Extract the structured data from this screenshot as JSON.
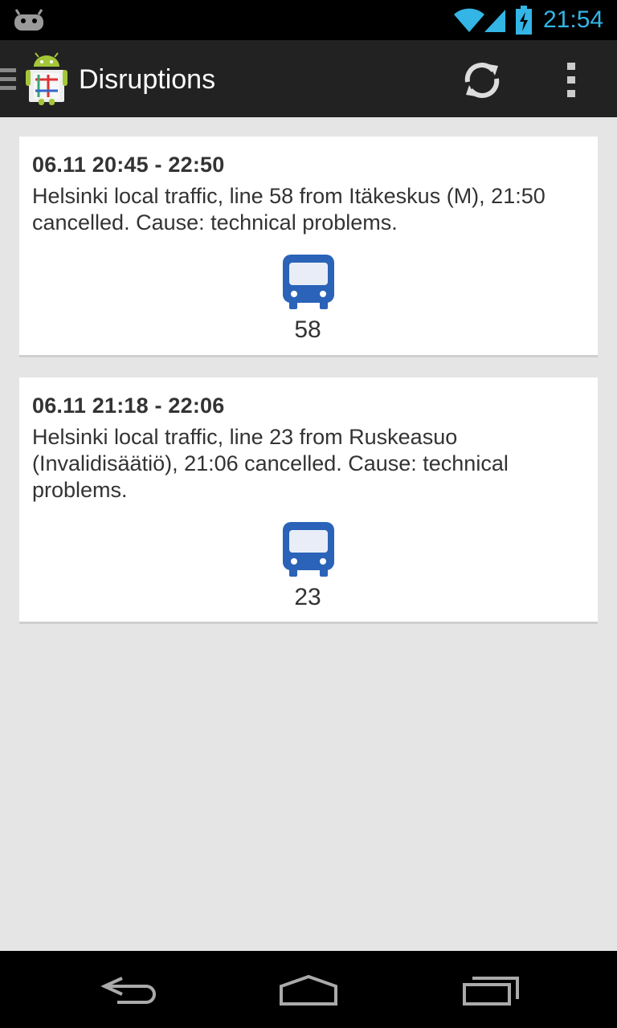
{
  "status_bar": {
    "time": "21:54",
    "icons": [
      "android-icon",
      "wifi-icon",
      "signal-icon",
      "battery-charging-icon"
    ]
  },
  "action_bar": {
    "title": "Disruptions",
    "icons": [
      "drawer-icon",
      "app-icon",
      "refresh-icon",
      "overflow-menu-icon"
    ]
  },
  "disruptions": [
    {
      "time": "06.11 20:45 - 22:50",
      "text": "Helsinki local traffic, line 58 from Itäkeskus (M), 21:50 cancelled. Cause: technical problems.",
      "line": "58",
      "icon": "bus-icon"
    },
    {
      "time": "06.11 21:18 - 22:06",
      "text": "Helsinki local traffic, line 23 from Ruskeasuo (Invalidisäätiö), 21:06 cancelled. Cause: technical problems.",
      "line": "23",
      "icon": "bus-icon"
    }
  ],
  "nav_bar": {
    "icons": [
      "back-icon",
      "home-icon",
      "recent-apps-icon"
    ]
  },
  "colors": {
    "accent": "#33b5e5",
    "bus": "#2a63b8",
    "action_bar": "#222222",
    "background": "#e5e5e5"
  }
}
